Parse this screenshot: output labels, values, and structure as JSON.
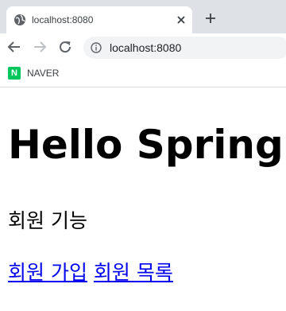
{
  "browser": {
    "tab": {
      "title": "localhost:8080",
      "favicon": "globe-icon",
      "close": "close-icon"
    },
    "new_tab": "plus-icon",
    "nav": {
      "back": "back-arrow-icon",
      "forward": "forward-arrow-icon",
      "reload": "reload-icon"
    },
    "address": {
      "url": "localhost:8080",
      "info_icon": "info-icon"
    },
    "bookmarks": [
      {
        "icon_text": "N",
        "label": "NAVER",
        "icon_color": "#03c75a"
      }
    ]
  },
  "page": {
    "heading": "Hello Spring",
    "subheading": "회원 기능",
    "links": [
      {
        "label": "회원 가입"
      },
      {
        "label": "회원 목록"
      }
    ],
    "link_color": "#0000ee"
  }
}
